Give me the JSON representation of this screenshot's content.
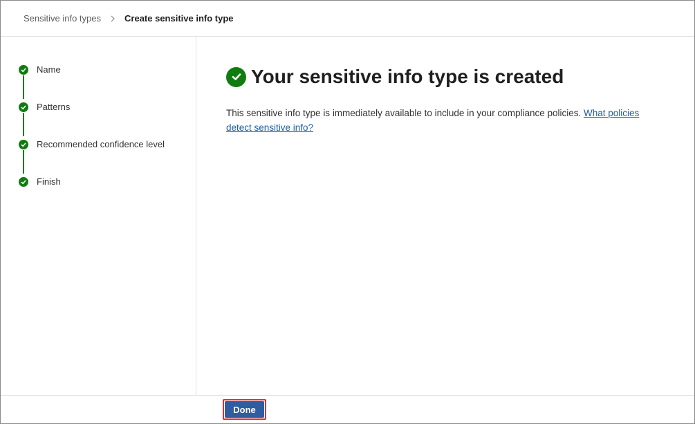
{
  "breadcrumb": {
    "parent": "Sensitive info types",
    "current": "Create sensitive info type"
  },
  "steps": [
    {
      "label": "Name",
      "status": "complete"
    },
    {
      "label": "Patterns",
      "status": "complete"
    },
    {
      "label": "Recommended confidence level",
      "status": "complete"
    },
    {
      "label": "Finish",
      "status": "complete"
    }
  ],
  "main": {
    "title": "Your sensitive info type is created",
    "description": "This sensitive info type is immediately available to include in your compliance policies.",
    "link_text": "What policies detect sensitive info?"
  },
  "footer": {
    "done_label": "Done"
  },
  "colors": {
    "success_green": "#107c10",
    "primary_button": "#2f5da0",
    "highlight_red": "#d13438",
    "link_blue": "#1b5e9e"
  },
  "icons": {
    "step_status": "checkmark-circle-icon",
    "breadcrumb_separator": "chevron-right-icon",
    "title_status": "checkmark-circle-icon"
  }
}
